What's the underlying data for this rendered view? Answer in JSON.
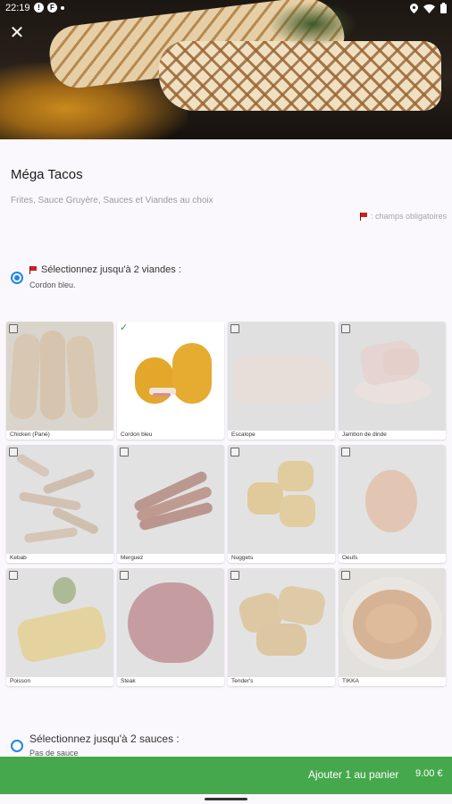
{
  "status_bar": {
    "time": "22:19",
    "icons": [
      "notification-icon",
      "app-icon",
      "dot-icon",
      "location-icon",
      "wifi-icon",
      "battery-icon"
    ]
  },
  "product": {
    "name": "Méga Tacos",
    "description": "Frites, Sauce Gruyère, Sauces et Viandes au choix",
    "required_legend": ": champs obligatoires"
  },
  "meat_group": {
    "title": "Sélectionnez jusqu'à 2 viandes :",
    "selected": "Cordon bleu.",
    "items": [
      {
        "label": "Chicken (Pané)",
        "selected": false
      },
      {
        "label": "Cordon bleu",
        "selected": true
      },
      {
        "label": "Escalope",
        "selected": false
      },
      {
        "label": "Jambon de dinde",
        "selected": false
      },
      {
        "label": "Kebab",
        "selected": false
      },
      {
        "label": "Merguez",
        "selected": false
      },
      {
        "label": "Nuggets",
        "selected": false
      },
      {
        "label": "Oeufs",
        "selected": false
      },
      {
        "label": "Poisson",
        "selected": false
      },
      {
        "label": "Steak",
        "selected": false
      },
      {
        "label": "Tender's",
        "selected": false
      },
      {
        "label": "TIKKA",
        "selected": false
      }
    ]
  },
  "sauce_group": {
    "title": "Sélectionnez jusqu'à 2 sauces :",
    "selected": "Pas de sauce"
  },
  "cart": {
    "add_label": "Ajouter 1 au panier",
    "price": "9.00 €"
  },
  "colors": {
    "accent": "#46a84c",
    "radio": "#1e88e5",
    "required_flag": "#d01e1e"
  }
}
